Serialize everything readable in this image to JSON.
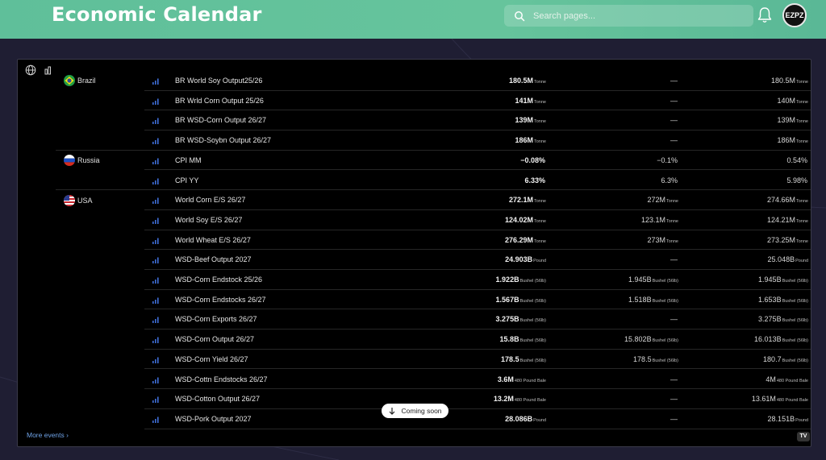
{
  "header": {
    "title": "Economic Calendar",
    "search_placeholder": "Search pages...",
    "avatar_initials": "EZPZ"
  },
  "widget": {
    "more_events": "More events",
    "coming_soon": "Coming soon",
    "watermark": "TV",
    "rows": [
      {
        "country": "Brazil",
        "flag": "brazil-flag",
        "event": "BR World Soy Output25/26",
        "actual": "180.5",
        "actual_suffix": "M",
        "actual_unit": "Tonne",
        "forecast": "—",
        "forecast_suffix": "",
        "forecast_unit": "",
        "prior": "180.5",
        "prior_suffix": "M",
        "prior_unit": "Tonne"
      },
      {
        "country": "",
        "event": "BR Wrld Corn Output 25/26",
        "actual": "141",
        "actual_suffix": "M",
        "actual_unit": "Tonne",
        "forecast": "—",
        "forecast_suffix": "",
        "forecast_unit": "",
        "prior": "140",
        "prior_suffix": "M",
        "prior_unit": "Tonne"
      },
      {
        "country": "",
        "event": "BR WSD-Corn Output 26/27",
        "actual": "139",
        "actual_suffix": "M",
        "actual_unit": "Tonne",
        "forecast": "—",
        "forecast_suffix": "",
        "forecast_unit": "",
        "prior": "139",
        "prior_suffix": "M",
        "prior_unit": "Tonne"
      },
      {
        "country": "",
        "event": "BR WSD-Soybn Output 26/27",
        "actual": "186",
        "actual_suffix": "M",
        "actual_unit": "Tonne",
        "forecast": "—",
        "forecast_suffix": "",
        "forecast_unit": "",
        "prior": "186",
        "prior_suffix": "M",
        "prior_unit": "Tonne",
        "group_end": true
      },
      {
        "country": "Russia",
        "flag": "russia-flag",
        "event": "CPI MM",
        "actual": "−0.08",
        "actual_suffix": "%",
        "actual_unit": "",
        "forecast": "−0.1",
        "forecast_suffix": "%",
        "forecast_unit": "",
        "prior": "0.54",
        "prior_suffix": "%",
        "prior_unit": ""
      },
      {
        "country": "",
        "event": "CPI YY",
        "actual": "6.33",
        "actual_suffix": "%",
        "actual_unit": "",
        "forecast": "6.3",
        "forecast_suffix": "%",
        "forecast_unit": "",
        "prior": "5.98",
        "prior_suffix": "%",
        "prior_unit": "",
        "group_end": true
      },
      {
        "country": "USA",
        "flag": "usa-flag",
        "event": "World Corn E/S 26/27",
        "actual": "272.1",
        "actual_suffix": "M",
        "actual_unit": "Tonne",
        "forecast": "272",
        "forecast_suffix": "M",
        "forecast_unit": "Tonne",
        "prior": "274.66",
        "prior_suffix": "M",
        "prior_unit": "Tonne"
      },
      {
        "country": "",
        "event": "World Soy E/S 26/27",
        "actual": "124.02",
        "actual_suffix": "M",
        "actual_unit": "Tonne",
        "forecast": "123.1",
        "forecast_suffix": "M",
        "forecast_unit": "Tonne",
        "prior": "124.21",
        "prior_suffix": "M",
        "prior_unit": "Tonne"
      },
      {
        "country": "",
        "event": "World Wheat E/S 26/27",
        "actual": "276.29",
        "actual_suffix": "M",
        "actual_unit": "Tonne",
        "forecast": "273",
        "forecast_suffix": "M",
        "forecast_unit": "Tonne",
        "prior": "273.25",
        "prior_suffix": "M",
        "prior_unit": "Tonne"
      },
      {
        "country": "",
        "event": "WSD-Beef Output 2027",
        "actual": "24.903",
        "actual_suffix": "B",
        "actual_unit": "Pound",
        "forecast": "—",
        "forecast_suffix": "",
        "forecast_unit": "",
        "prior": "25.048",
        "prior_suffix": "B",
        "prior_unit": "Pound"
      },
      {
        "country": "",
        "event": "WSD-Corn Endstock 25/26",
        "actual": "1.922",
        "actual_suffix": "B",
        "actual_unit": "Bushel (56lb)",
        "forecast": "1.945",
        "forecast_suffix": "B",
        "forecast_unit": "Bushel (56lb)",
        "prior": "1.945",
        "prior_suffix": "B",
        "prior_unit": "Bushel (56lb)"
      },
      {
        "country": "",
        "event": "WSD-Corn Endstocks 26/27",
        "actual": "1.567",
        "actual_suffix": "B",
        "actual_unit": "Bushel (56lb)",
        "forecast": "1.518",
        "forecast_suffix": "B",
        "forecast_unit": "Bushel (56lb)",
        "prior": "1.653",
        "prior_suffix": "B",
        "prior_unit": "Bushel (56lb)"
      },
      {
        "country": "",
        "event": "WSD-Corn Exports 26/27",
        "actual": "3.275",
        "actual_suffix": "B",
        "actual_unit": "Bushel (56lb)",
        "forecast": "—",
        "forecast_suffix": "",
        "forecast_unit": "",
        "prior": "3.275",
        "prior_suffix": "B",
        "prior_unit": "Bushel (56lb)"
      },
      {
        "country": "",
        "event": "WSD-Corn Output 26/27",
        "actual": "15.8",
        "actual_suffix": "B",
        "actual_unit": "Bushel (56lb)",
        "forecast": "15.802",
        "forecast_suffix": "B",
        "forecast_unit": "Bushel (56lb)",
        "prior": "16.013",
        "prior_suffix": "B",
        "prior_unit": "Bushel (56lb)"
      },
      {
        "country": "",
        "event": "WSD-Corn Yield 26/27",
        "actual": "178.5",
        "actual_suffix": "",
        "actual_unit": "Bushel (56lb)",
        "forecast": "178.5",
        "forecast_suffix": "",
        "forecast_unit": "Bushel (56lb)",
        "prior": "180.7",
        "prior_suffix": "",
        "prior_unit": "Bushel (56lb)"
      },
      {
        "country": "",
        "event": "WSD-Cottn Endstocks 26/27",
        "actual": "3.6",
        "actual_suffix": "M",
        "actual_unit": "480 Pound Bale",
        "forecast": "—",
        "forecast_suffix": "",
        "forecast_unit": "",
        "prior": "4",
        "prior_suffix": "M",
        "prior_unit": "480 Pound Bale"
      },
      {
        "country": "",
        "event": "WSD-Cotton Output 26/27",
        "actual": "13.2",
        "actual_suffix": "M",
        "actual_unit": "480 Pound Bale",
        "forecast": "—",
        "forecast_suffix": "",
        "forecast_unit": "",
        "prior": "13.61",
        "prior_suffix": "M",
        "prior_unit": "480 Pound Bale"
      },
      {
        "country": "",
        "event": "WSD-Pork Output 2027",
        "actual": "28.086",
        "actual_suffix": "B",
        "actual_unit": "Pound",
        "forecast": "—",
        "forecast_suffix": "",
        "forecast_unit": "",
        "prior": "28.151",
        "prior_suffix": "B",
        "prior_unit": "Pound"
      }
    ]
  }
}
